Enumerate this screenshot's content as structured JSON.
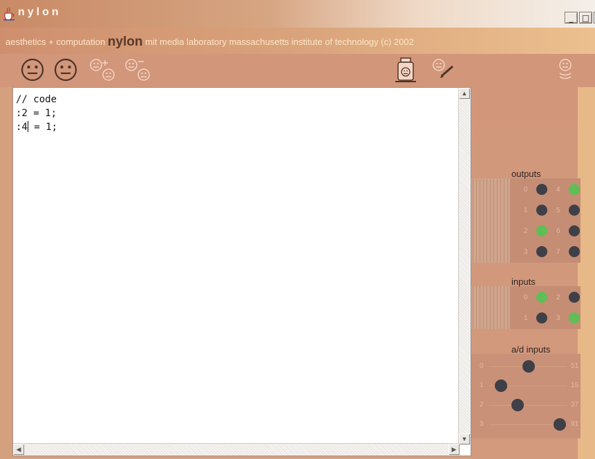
{
  "window": {
    "title": "nylon",
    "min_label": "_",
    "max_label": "□",
    "close_label": "✕"
  },
  "header": {
    "prefix": "aesthetics + computation",
    "brand": "nylon",
    "suffix": "mit media laboratory  massachusetts institute of technology  (c) 2002"
  },
  "toolbar": {
    "icons": [
      "face-icon",
      "face-icon",
      "add-face-icon",
      "remove-face-icon",
      "jar-icon",
      "edit-face-icon",
      "stack-face-icon"
    ]
  },
  "editor": {
    "lines": [
      "// code",
      ":2 = 1;",
      ":4",
      " = 1;"
    ]
  },
  "outputs": {
    "label": "outputs",
    "pins": [
      {
        "num": "0",
        "on": false
      },
      {
        "num": "4",
        "on": true
      },
      {
        "num": "1",
        "on": false
      },
      {
        "num": "5",
        "on": false
      },
      {
        "num": "2",
        "on": true
      },
      {
        "num": "6",
        "on": false
      },
      {
        "num": "3",
        "on": false
      },
      {
        "num": "7",
        "on": false
      }
    ]
  },
  "inputs": {
    "label": "inputs",
    "pins": [
      {
        "num": "0",
        "on": true
      },
      {
        "num": "2",
        "on": false
      },
      {
        "num": "1",
        "on": false
      },
      {
        "num": "3",
        "on": true
      }
    ]
  },
  "ad_inputs": {
    "label": "a/d inputs",
    "channels": [
      {
        "num": "0",
        "value": "51",
        "level": 0.51
      },
      {
        "num": "1",
        "value": "15",
        "level": 0.15
      },
      {
        "num": "2",
        "value": "37",
        "level": 0.37
      },
      {
        "num": "3",
        "value": "91",
        "level": 0.91
      }
    ]
  },
  "colors": {
    "led_on": "#5fbe55",
    "led_off": "#3f3f48"
  }
}
